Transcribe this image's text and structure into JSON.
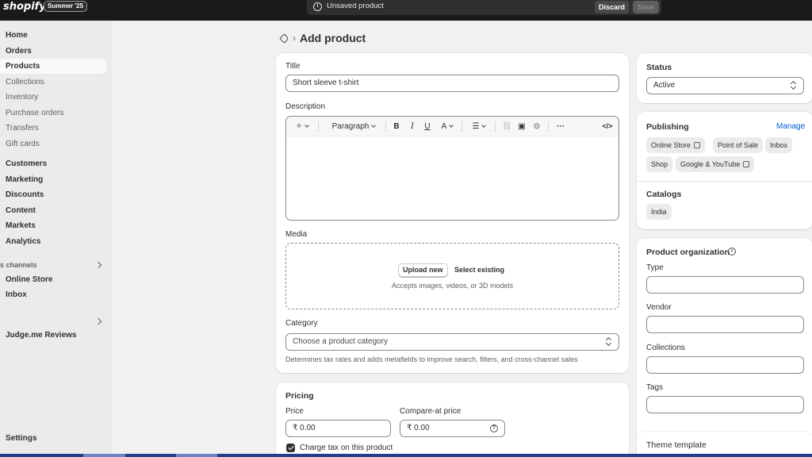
{
  "topbar": {
    "logo": "shopify",
    "edition_badge": "Summer '25",
    "unsaved_message": "Unsaved product",
    "discard_label": "Discard",
    "save_label": "Save"
  },
  "sidebar": {
    "items": [
      {
        "label": "Home"
      },
      {
        "label": "Orders"
      },
      {
        "label": "Products"
      },
      {
        "label": "Collections"
      },
      {
        "label": "Inventory"
      },
      {
        "label": "Purchase orders"
      },
      {
        "label": "Transfers"
      },
      {
        "label": "Gift cards"
      },
      {
        "label": "Customers"
      },
      {
        "label": "Marketing"
      },
      {
        "label": "Discounts"
      },
      {
        "label": "Content"
      },
      {
        "label": "Markets"
      },
      {
        "label": "Analytics"
      }
    ],
    "sales_channels_label": "s channels",
    "channels": [
      {
        "label": "Online Store"
      },
      {
        "label": "Inbox"
      }
    ],
    "apps": [
      {
        "label": "Judge.me Reviews"
      }
    ],
    "settings_label": "Settings"
  },
  "page": {
    "title": "Add product",
    "breadcrumb_sep": "›"
  },
  "product": {
    "title_label": "Title",
    "title_value": "Short sleeve t-shirt",
    "description_label": "Description",
    "editor": {
      "paragraph_label": "Paragraph",
      "bold": "B",
      "italic": "I",
      "underline": "U",
      "text_color": "A",
      "more": "···",
      "code": "</>"
    },
    "media_label": "Media",
    "upload_new": "Upload new",
    "select_existing": "Select existing",
    "media_hint": "Accepts images, videos, or 3D models",
    "category_label": "Category",
    "category_placeholder": "Choose a product category",
    "category_help": "Determines tax rates and adds metafields to improve search, filters, and cross-channel sales"
  },
  "pricing": {
    "heading": "Pricing",
    "price_label": "Price",
    "price_value": "₹ 0.00",
    "compare_label": "Compare-at price",
    "compare_value": "₹ 0.00",
    "charge_tax_label": "Charge tax on this product",
    "charge_tax_checked": true
  },
  "status": {
    "heading": "Status",
    "value": "Active"
  },
  "publishing": {
    "heading": "Publishing",
    "manage_label": "Manage",
    "channels": [
      "Online Store",
      "Point of Sale",
      "Inbox",
      "Shop",
      "Google & YouTube"
    ],
    "catalogs_heading": "Catalogs",
    "catalogs": [
      "India"
    ]
  },
  "organization": {
    "heading": "Product organization",
    "type_label": "Type",
    "vendor_label": "Vendor",
    "collections_label": "Collections",
    "tags_label": "Tags"
  },
  "theme": {
    "heading": "Theme template"
  },
  "colors": {
    "topbar": "#1a1a1a",
    "link": "#005bd3",
    "taskbar": "#1f3f8a"
  }
}
